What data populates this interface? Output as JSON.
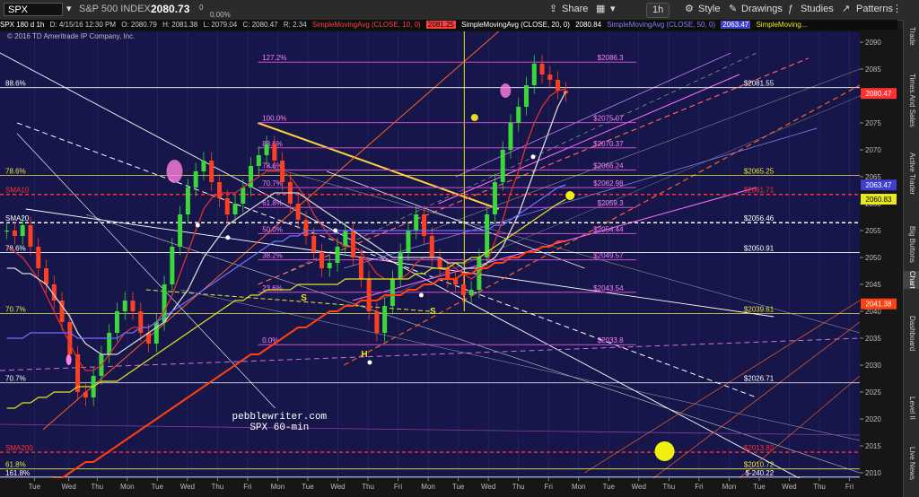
{
  "toolbar": {
    "symbol": "SPX",
    "description": "S&P 500 INDEX",
    "last_price": "2080.73",
    "change": "0",
    "change_pct": "0.00%",
    "share_label": "Share",
    "interval": "1h",
    "style_label": "Style",
    "drawings_label": "Drawings",
    "studies_label": "Studies",
    "patterns_label": "Patterns"
  },
  "header": {
    "name": "SPX 180 d 1h",
    "datetime": "D: 4/15/16 12:30 PM",
    "open": "O: 2080.79",
    "high": "H: 2081.38",
    "low": "L: 2079.04",
    "close": "C: 2080.47",
    "range": "R: 2.34",
    "sma10": "SimpleMovingAvg (CLOSE, 10, 0)",
    "sma10_val": "2081.25",
    "sma20": "SimpleMovingAvg (CLOSE, 20, 0)",
    "sma20_val": "2080.84",
    "sma50": "SimpleMovingAvg (CLOSE, 50, 0)",
    "sma50_val": "2063.47",
    "sma_more": "SimpleMoving..."
  },
  "side_tabs": [
    "Trade",
    "Times And Sales",
    "Active Trader",
    "Big Buttons",
    "Chart",
    "Dashboard",
    "Level II",
    "Live News"
  ],
  "chart_data": {
    "type": "line",
    "copyright": "© 2016 TD Ameritrade IP Company, Inc.",
    "watermark": [
      "pebblewriter.com",
      "SPX 60-min"
    ],
    "ylim": [
      2009,
      2092
    ],
    "xlim": [
      0,
      100
    ],
    "y_ticks": [
      2010,
      2015,
      2020,
      2025,
      2030,
      2035,
      2040,
      2045,
      2050,
      2055,
      2060,
      2065,
      2070,
      2075,
      2080,
      2085,
      2090
    ],
    "x_ticks": [
      {
        "x": 4,
        "label": "Tue"
      },
      {
        "x": 8,
        "label": "Wed"
      },
      {
        "x": 11.3,
        "label": "Thu"
      },
      {
        "x": 14.8,
        "label": "Mon"
      },
      {
        "x": 18.3,
        "label": "Tue"
      },
      {
        "x": 21.8,
        "label": "Wed"
      },
      {
        "x": 25.3,
        "label": "Thu"
      },
      {
        "x": 28.8,
        "label": "Fri"
      },
      {
        "x": 32.3,
        "label": "Mon"
      },
      {
        "x": 35.8,
        "label": "Tue"
      },
      {
        "x": 39.3,
        "label": "Wed"
      },
      {
        "x": 42.8,
        "label": "Thu"
      },
      {
        "x": 46.3,
        "label": "Fri"
      },
      {
        "x": 49.8,
        "label": "Mon"
      },
      {
        "x": 53.3,
        "label": "Tue"
      },
      {
        "x": 56.8,
        "label": "Wed"
      },
      {
        "x": 60.3,
        "label": "Thu"
      },
      {
        "x": 63.8,
        "label": "Fri"
      },
      {
        "x": 67.3,
        "label": "Mon"
      },
      {
        "x": 70.8,
        "label": "Tue"
      },
      {
        "x": 74.3,
        "label": "Wed"
      },
      {
        "x": 77.8,
        "label": "Thu"
      },
      {
        "x": 81.3,
        "label": "Fri"
      },
      {
        "x": 84.8,
        "label": "Mon"
      },
      {
        "x": 88.3,
        "label": "Tue"
      },
      {
        "x": 91.8,
        "label": "Wed"
      },
      {
        "x": 95.3,
        "label": "Thu"
      },
      {
        "x": 98.8,
        "label": "Fri"
      }
    ],
    "close_series": [
      2055,
      2054,
      2056,
      2052,
      2048,
      2045,
      2042,
      2038,
      2032,
      2025,
      2024,
      2028,
      2032,
      2036,
      2040,
      2042,
      2040,
      2036,
      2034,
      2038,
      2045,
      2052,
      2058,
      2063,
      2066,
      2068,
      2064,
      2061,
      2058,
      2060,
      2063,
      2067,
      2069,
      2071,
      2068,
      2064,
      2060,
      2057,
      2054,
      2051,
      2048,
      2049,
      2052,
      2055,
      2050,
      2046,
      2040,
      2036,
      2041,
      2046,
      2051,
      2055,
      2058,
      2054,
      2050,
      2048,
      2046,
      2045,
      2043,
      2044,
      2050,
      2058,
      2064,
      2070,
      2075,
      2078,
      2082,
      2086,
      2084,
      2083,
      2081,
      2080.5
    ],
    "sma_series": [
      {
        "name": "SMA10",
        "color": "#e03030",
        "values": [
          2052,
          2051,
          2050,
          2048,
          2046,
          2043,
          2040,
          2037,
          2034,
          2031,
          2029,
          2029,
          2030,
          2032,
          2034,
          2036,
          2037,
          2037,
          2037,
          2038,
          2040,
          2043,
          2047,
          2051,
          2055,
          2059,
          2061,
          2062,
          2062,
          2062,
          2063,
          2064,
          2065,
          2066,
          2066,
          2066,
          2065,
          2063,
          2061,
          2058,
          2056,
          2054,
          2053,
          2052,
          2052,
          2051,
          2049,
          2047,
          2046,
          2046,
          2046,
          2047,
          2049,
          2050,
          2050,
          2050,
          2049,
          2048,
          2047,
          2046,
          2047,
          2049,
          2053,
          2057,
          2062,
          2066,
          2071,
          2075,
          2078,
          2080,
          2081,
          2081.3
        ]
      },
      {
        "name": "SMA20",
        "color": "#d8d8d8",
        "values": [
          2048,
          2048,
          2047,
          2047,
          2046,
          2045,
          2043,
          2041,
          2039,
          2036,
          2034,
          2033,
          2032,
          2032,
          2032,
          2033,
          2034,
          2035,
          2036,
          2037,
          2038,
          2040,
          2042,
          2044,
          2047,
          2050,
          2052,
          2054,
          2056,
          2057,
          2058,
          2059,
          2060,
          2061,
          2062,
          2062,
          2062,
          2062,
          2061,
          2060,
          2059,
          2058,
          2057,
          2056,
          2055,
          2054,
          2053,
          2052,
          2051,
          2050,
          2050,
          2050,
          2050,
          2050,
          2050,
          2050,
          2049,
          2049,
          2048,
          2048,
          2048,
          2049,
          2050,
          2052,
          2055,
          2058,
          2062,
          2066,
          2070,
          2074,
          2078,
          2080.8
        ]
      },
      {
        "name": "SMA50",
        "color": "#6f6fff",
        "values": [
          2035,
          2035,
          2035,
          2036,
          2036,
          2036,
          2036,
          2036,
          2036,
          2035,
          2035,
          2035,
          2035,
          2035,
          2035,
          2036,
          2036,
          2037,
          2037,
          2038,
          2039,
          2040,
          2041,
          2042,
          2043,
          2044,
          2045,
          2046,
          2047,
          2048,
          2049,
          2050,
          2051,
          2052,
          2053,
          2053,
          2054,
          2054,
          2055,
          2055,
          2055,
          2055,
          2055,
          2055,
          2055,
          2055,
          2055,
          2055,
          2055,
          2055,
          2055,
          2055,
          2055,
          2055,
          2055,
          2055,
          2055,
          2055,
          2055,
          2055,
          2055,
          2055,
          2056,
          2056,
          2057,
          2058,
          2059,
          2060,
          2061,
          2062,
          2063,
          2063.5
        ]
      },
      {
        "name": "SMA100",
        "color": "#e0e020",
        "values": [
          2022,
          2022,
          2023,
          2023,
          2024,
          2024,
          2025,
          2025,
          2025,
          2026,
          2026,
          2026,
          2027,
          2027,
          2027,
          2028,
          2029,
          2030,
          2031,
          2032,
          2033,
          2034,
          2035,
          2036,
          2037,
          2038,
          2039,
          2040,
          2041,
          2042,
          2042,
          2043,
          2043,
          2044,
          2044,
          2044,
          2044,
          2045,
          2045,
          2045,
          2045,
          2045,
          2045,
          2046,
          2046,
          2046,
          2046,
          2046,
          2046,
          2046,
          2046,
          2046,
          2047,
          2047,
          2048,
          2048,
          2048,
          2049,
          2049,
          2050,
          2050,
          2051,
          2052,
          2053,
          2054,
          2055,
          2056,
          2057,
          2058,
          2059,
          2060,
          2060.8
        ]
      },
      {
        "name": "SMA200",
        "color": "#ff4010",
        "values": [
          2005,
          2006,
          2006,
          2007,
          2008,
          2008,
          2009,
          2009,
          2010,
          2011,
          2012,
          2012,
          2013,
          2014,
          2015,
          2016,
          2017,
          2018,
          2019,
          2020,
          2021,
          2022,
          2023,
          2024,
          2025,
          2026,
          2027,
          2028,
          2029,
          2030,
          2031,
          2032,
          2032,
          2033,
          2034,
          2035,
          2036,
          2037,
          2037,
          2038,
          2039,
          2040,
          2040,
          2041,
          2041,
          2042,
          2042,
          2042,
          2043,
          2043,
          2043,
          2044,
          2044,
          2045,
          2045,
          2046,
          2046,
          2046,
          2047,
          2047,
          2048,
          2048,
          2049,
          2049,
          2050,
          2050,
          2051,
          2051,
          2052,
          2052,
          2053,
          2053
        ]
      }
    ],
    "fib_levels": [
      {
        "label": "127.2%",
        "value": "$2086.3",
        "y": 2086.3
      },
      {
        "label": "100.0%",
        "value": "$2075.07",
        "y": 2075.07
      },
      {
        "label": "88.6%",
        "value": "$2070.37",
        "y": 2070.37
      },
      {
        "label": "78.6%",
        "value": "$2066.24",
        "y": 2066.24
      },
      {
        "label": "70.7%",
        "value": "$2062.98",
        "y": 2062.98
      },
      {
        "label": "61.8%",
        "value": "$2059.3",
        "y": 2059.3
      },
      {
        "label": "50.0%",
        "value": "$2054.44",
        "y": 2054.44
      },
      {
        "label": "38.2%",
        "value": "$2049.57",
        "y": 2049.57
      },
      {
        "label": "23.6%",
        "value": "$2043.54",
        "y": 2043.54
      },
      {
        "label": "0.0%",
        "value": "$2033.8",
        "y": 2033.8
      }
    ],
    "horizontal_levels": [
      {
        "left": "88.6%",
        "right": "$2081.55",
        "y": 2081.55,
        "color": "#ffffff"
      },
      {
        "left": "78.6%",
        "right": "$2065.25",
        "y": 2065.25,
        "color": "#e8e840"
      },
      {
        "left": "SMA10",
        "right": "$2061.71",
        "y": 2061.71,
        "color": "#ff3030"
      },
      {
        "left": "SMA20",
        "right": "$2056.46",
        "y": 2056.46,
        "color": "#ffffff"
      },
      {
        "left": "78.6%",
        "right": "$2050.91",
        "y": 2050.91,
        "color": "#ffffff"
      },
      {
        "left": "70.7%",
        "right": "$2039.61",
        "y": 2039.61,
        "color": "#e8e840"
      },
      {
        "left": "70.7%",
        "right": "$2026.71",
        "y": 2026.71,
        "color": "#ffffff"
      },
      {
        "left": "SMA200",
        "right": "$2013.82",
        "y": 2013.82,
        "color": "#ff3030"
      },
      {
        "left": "61.8%",
        "right": "$2010.72",
        "y": 2010.72,
        "color": "#e8e840"
      },
      {
        "left": "161.8%",
        "right": "$-240.22",
        "y": 2009.2,
        "color": "#ffffff"
      }
    ],
    "price_tags": [
      {
        "value": "2080.47",
        "y": 2080.47,
        "bg": "#ff3030",
        "fg": "#ffffff"
      },
      {
        "value": "2063.47",
        "y": 2063.47,
        "bg": "#4040d0",
        "fg": "#ffffff"
      },
      {
        "value": "2060.83",
        "y": 2060.83,
        "bg": "#e8e820",
        "fg": "#000000"
      },
      {
        "value": "2041.38",
        "y": 2041.38,
        "bg": "#ff4010",
        "fg": "#ffffff"
      }
    ],
    "pattern_labels": [
      {
        "text": "S",
        "x": 35,
        "y": 2042
      },
      {
        "text": "H",
        "x": 42,
        "y": 2031.5
      },
      {
        "text": "S",
        "x": 50,
        "y": 2039.5
      }
    ]
  }
}
